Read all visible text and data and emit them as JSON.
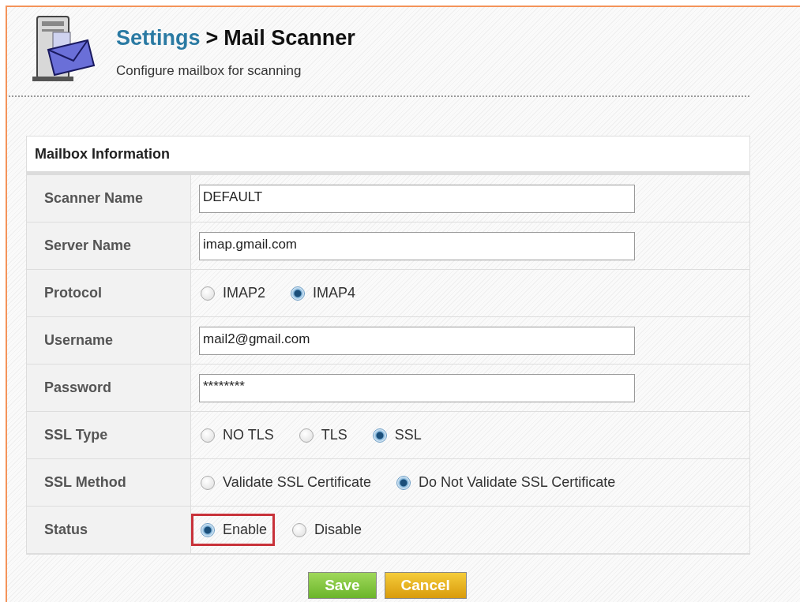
{
  "header": {
    "breadcrumb_link": "Settings",
    "separator": ">",
    "title": "Mail Scanner",
    "subtitle": "Configure mailbox for scanning"
  },
  "panel": {
    "title": "Mailbox Information",
    "rows": [
      {
        "kind": "text",
        "label": "Scanner Name",
        "value": "DEFAULT"
      },
      {
        "kind": "text",
        "label": "Server Name",
        "value": "imap.gmail.com"
      },
      {
        "kind": "radio",
        "label": "Protocol",
        "options": [
          {
            "label": "IMAP2",
            "selected": false,
            "highlighted": false
          },
          {
            "label": "IMAP4",
            "selected": true,
            "highlighted": false
          }
        ]
      },
      {
        "kind": "text",
        "label": "Username",
        "value": "mail2@gmail.com"
      },
      {
        "kind": "text",
        "label": "Password",
        "value": "********"
      },
      {
        "kind": "radio",
        "label": "SSL Type",
        "options": [
          {
            "label": "NO TLS",
            "selected": false,
            "highlighted": false
          },
          {
            "label": "TLS",
            "selected": false,
            "highlighted": false
          },
          {
            "label": "SSL",
            "selected": true,
            "highlighted": false
          }
        ]
      },
      {
        "kind": "radio",
        "label": "SSL Method",
        "options": [
          {
            "label": "Validate SSL Certificate",
            "selected": false,
            "highlighted": false
          },
          {
            "label": "Do Not Validate SSL Certificate",
            "selected": true,
            "highlighted": false
          }
        ]
      },
      {
        "kind": "radio",
        "label": "Status",
        "options": [
          {
            "label": "Enable",
            "selected": true,
            "highlighted": true
          },
          {
            "label": "Disable",
            "selected": false,
            "highlighted": false
          }
        ]
      }
    ]
  },
  "buttons": [
    {
      "kind": "save",
      "label": "Save"
    },
    {
      "kind": "cancel",
      "label": "Cancel"
    }
  ]
}
